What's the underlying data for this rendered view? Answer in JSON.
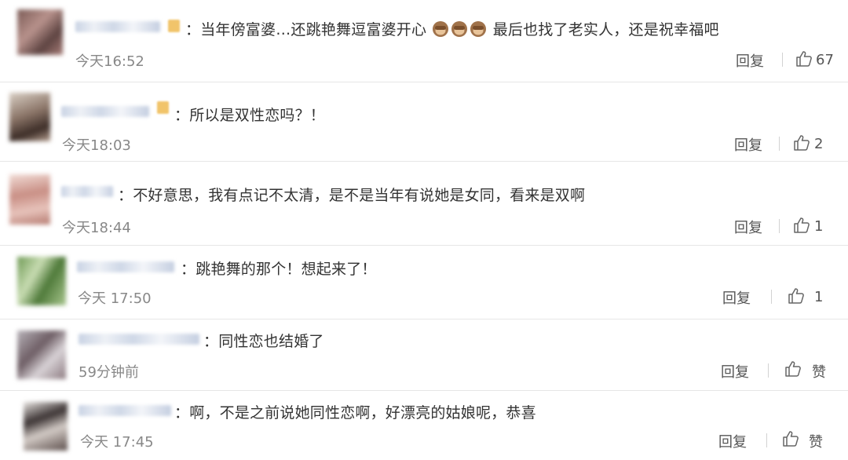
{
  "comments": [
    {
      "text_before": "：当年傍富婆…还跳艳舞逗富婆开心",
      "text_after": "最后也找了老实人，还是祝幸福吧",
      "emoji": "see-no-evil-monkey-icon",
      "time": "今天16:52",
      "reply": "回复",
      "likes": "67"
    },
    {
      "text": "：所以是双性恋吗？！",
      "time": "今天18:03",
      "reply": "回复",
      "likes": "2"
    },
    {
      "text": "：不好意思，我有点记不太清，是不是当年有说她是女同，看来是双啊",
      "time": "今天18:44",
      "reply": "回复",
      "likes": "1"
    },
    {
      "text": "：跳艳舞的那个！想起来了！",
      "time": "今天 17:50",
      "reply": "回复",
      "likes": "1"
    },
    {
      "text": "：同性恋也结婚了",
      "time": "59分钟前",
      "reply": "回复",
      "likes": "赞"
    },
    {
      "text": "：啊，不是之前说她同性恋啊，好漂亮的姑娘呢，恭喜",
      "time": "今天 17:45",
      "reply": "回复",
      "likes": "赞"
    }
  ],
  "colors": {
    "text": "#333333",
    "time": "#888888",
    "separator": "#e6e6e6"
  }
}
